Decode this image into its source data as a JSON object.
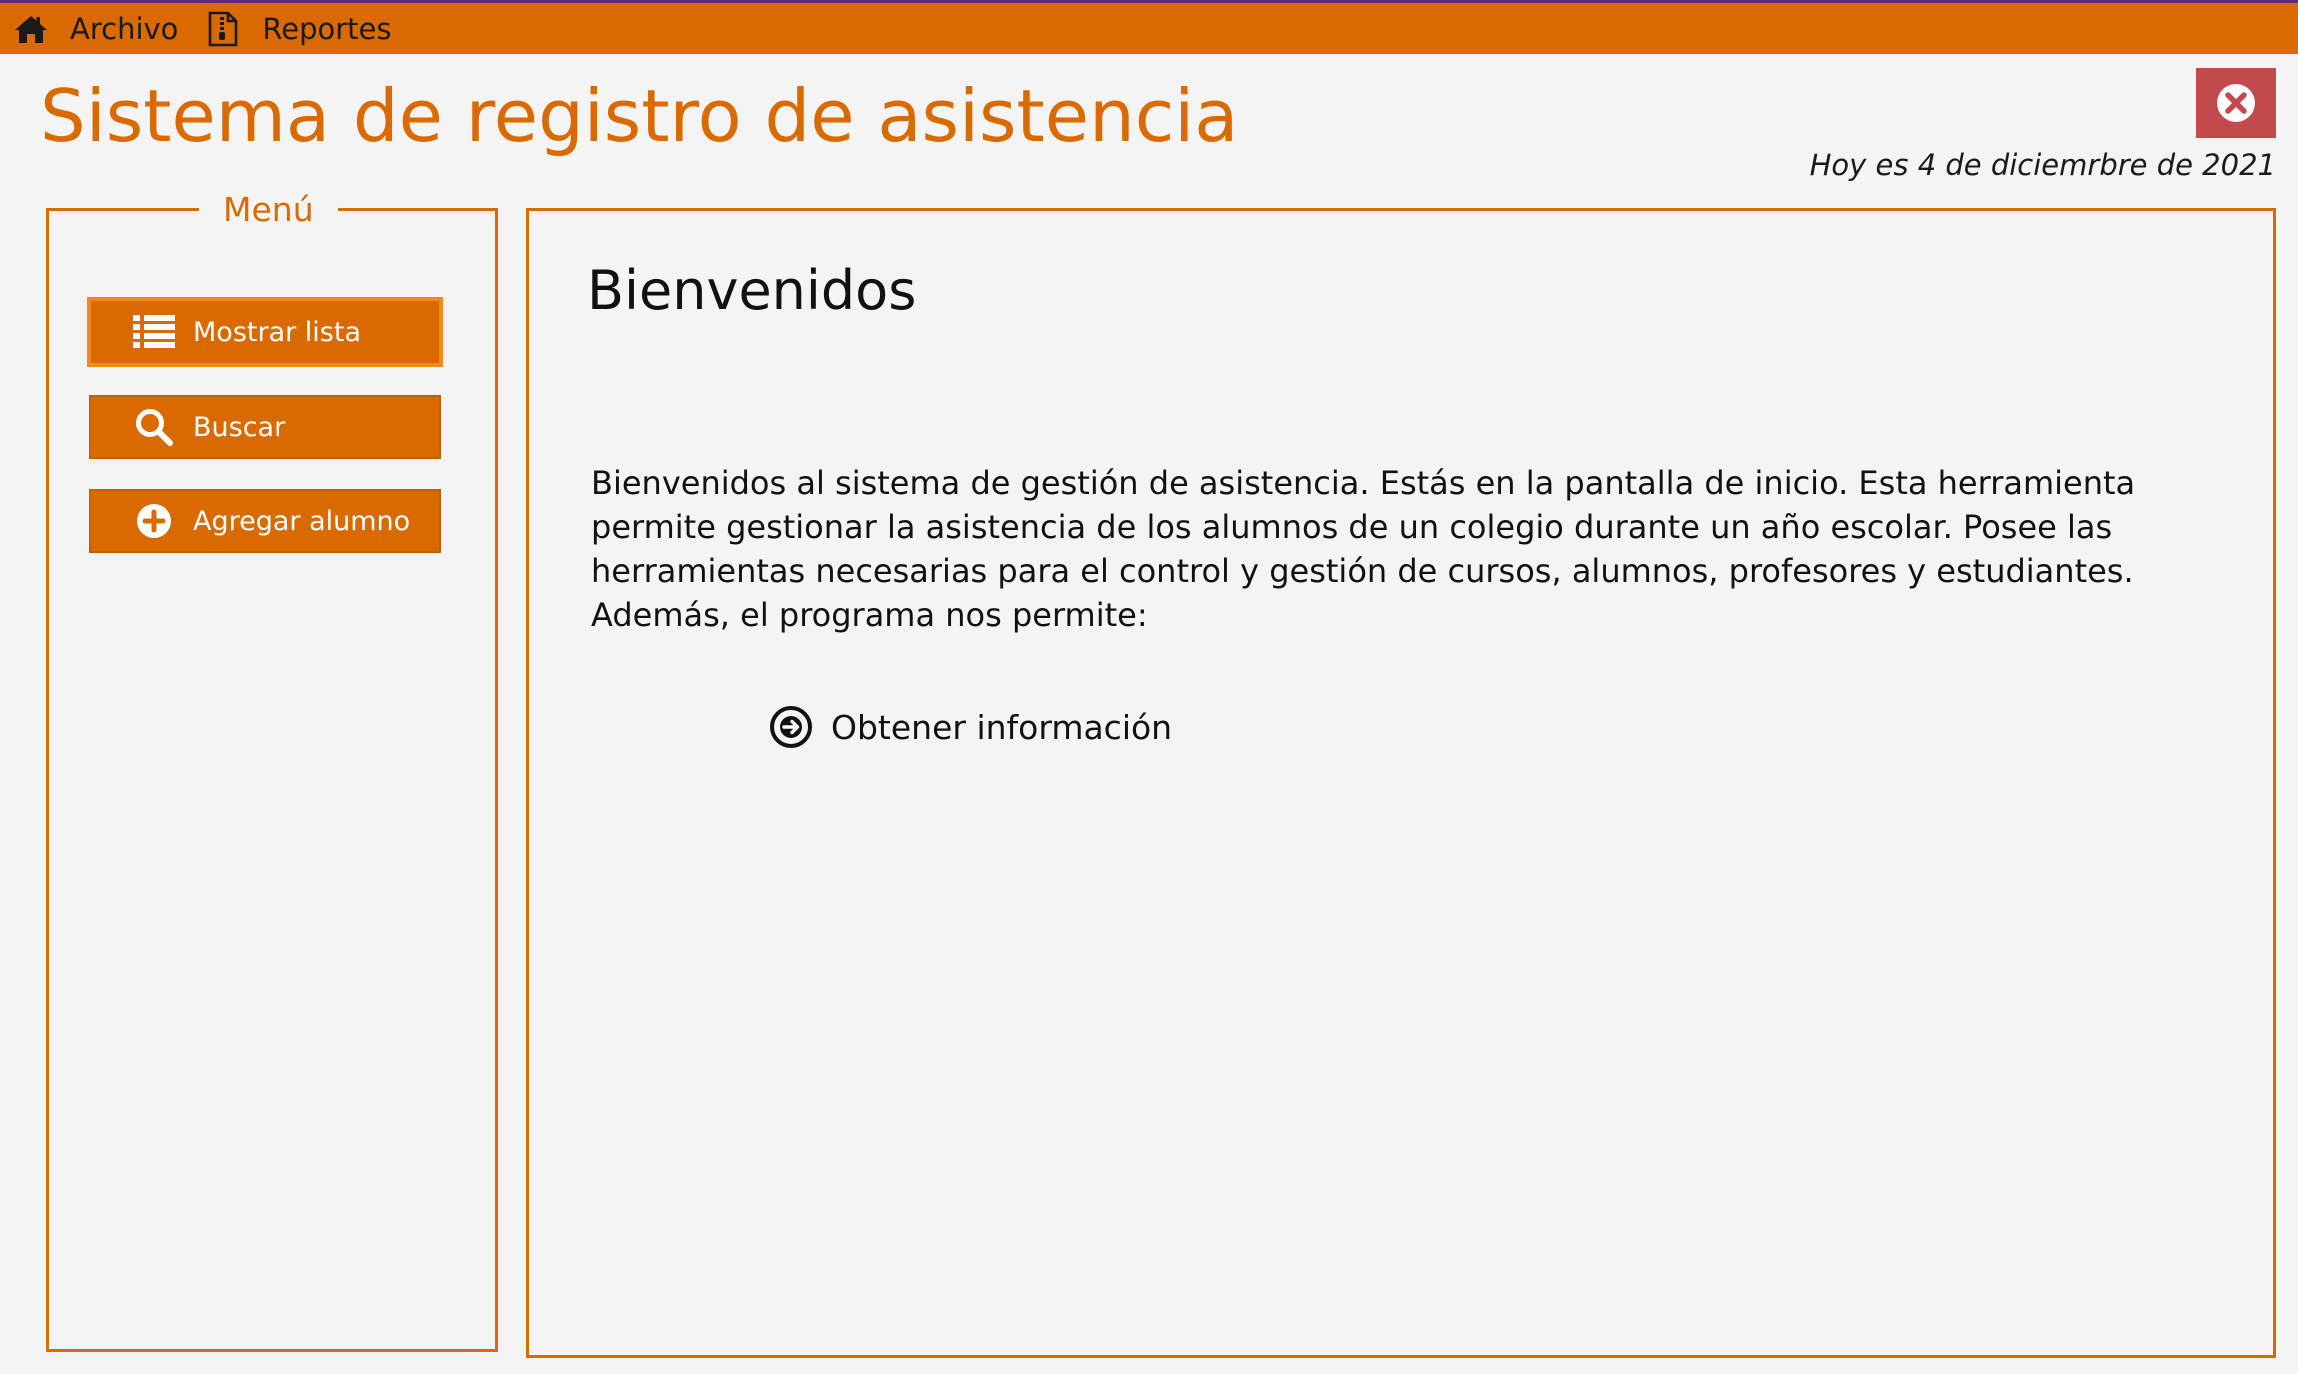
{
  "colors": {
    "accent": "#d96a00",
    "close_button": "#c24a4d",
    "background": "#f4f4f4"
  },
  "menubar": {
    "items": [
      {
        "label": "Archivo",
        "icon": "home-icon"
      },
      {
        "label": "Reportes",
        "icon": "report-file-icon"
      }
    ]
  },
  "header": {
    "title": "Sistema de registro de asistencia",
    "date_text": "Hoy es 4 de diciemrbre de 2021",
    "close_icon": "close-circle-icon"
  },
  "menu": {
    "legend": "Menú",
    "buttons": [
      {
        "label": "Mostrar lista",
        "icon": "list-icon",
        "active": true
      },
      {
        "label": "Buscar",
        "icon": "search-icon",
        "active": false
      },
      {
        "label": "Agregar alumno",
        "icon": "add-circle-icon",
        "active": false
      }
    ]
  },
  "content": {
    "heading": "Bienvenidos",
    "paragraph": "Bienvenidos al sistema de gestión de asistencia.  Estás en la pantalla de inicio. Esta herramienta permite gestionar la asistencia de los alumnos de un colegio durante un año escolar. Posee las herramientas necesarias para el control y gestión de cursos, alumnos, profesores y estudiantes. Además, el programa nos permite:",
    "link_label": "Obtener información",
    "link_icon": "arrow-right-circle-icon"
  }
}
